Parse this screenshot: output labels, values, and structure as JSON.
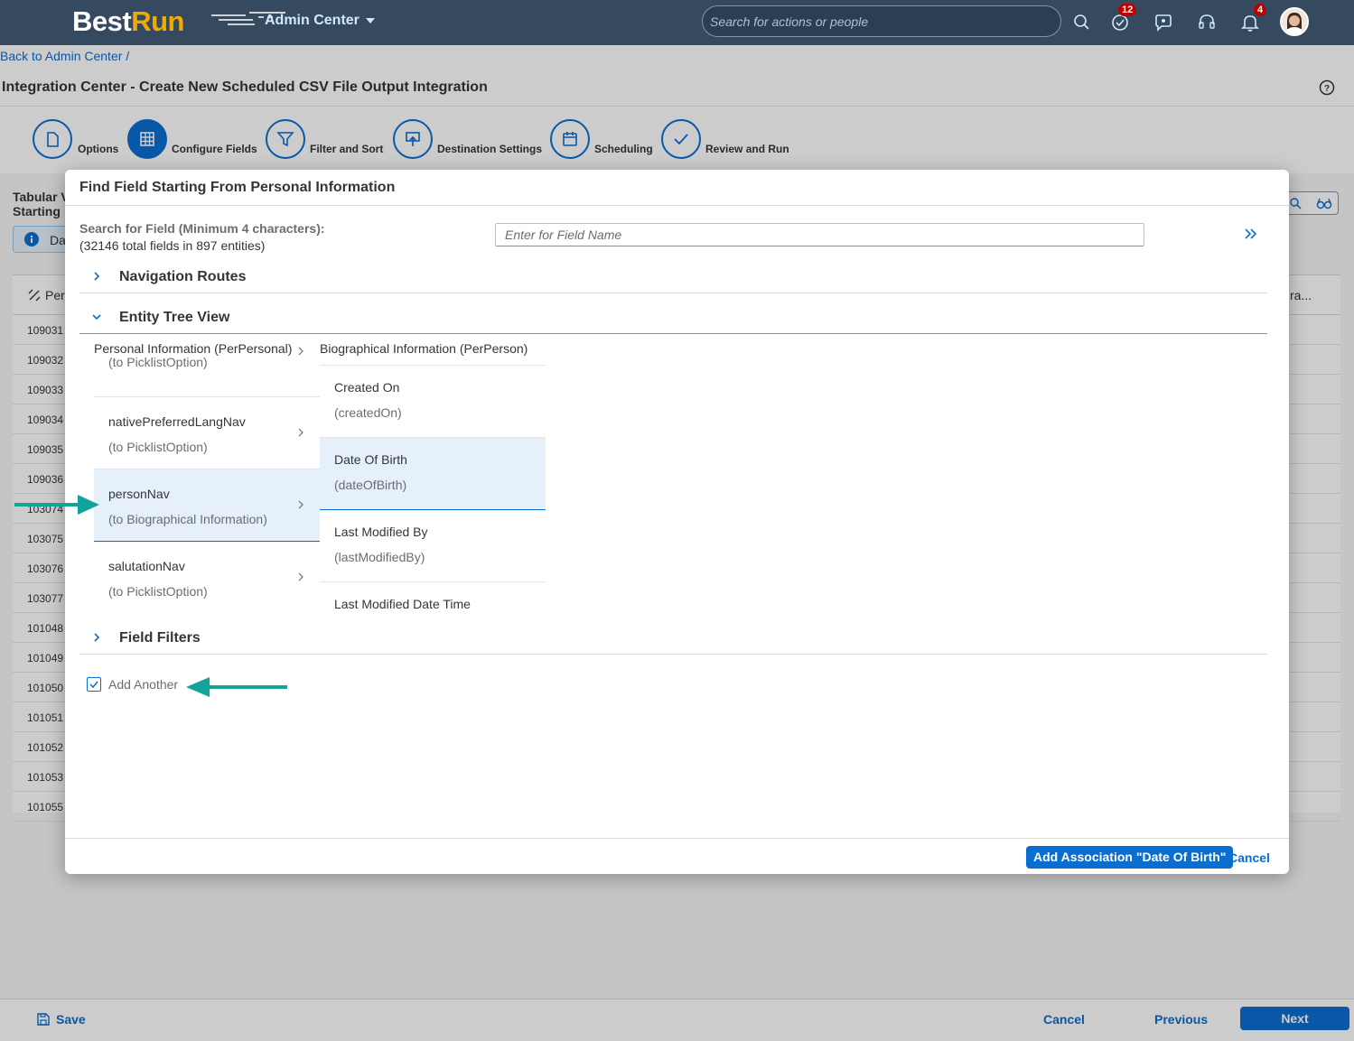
{
  "shell": {
    "logo_best": "Best",
    "logo_run": "Run",
    "menu_title": "Admin Center",
    "search_placeholder": "Search for actions or people",
    "todo_count": "12",
    "notif_count": "4",
    "brand_color": "#354a5f",
    "accent_color": "#f0ab00"
  },
  "breadcrumb": "Back to Admin Center /",
  "page_title": "Integration Center - Create New Scheduled CSV File Output Integration",
  "wizard": {
    "steps": [
      {
        "label": "Options",
        "icon": "document-icon",
        "active": false
      },
      {
        "label": "Configure Fields",
        "icon": "grid-icon",
        "active": true
      },
      {
        "label": "Filter and Sort",
        "icon": "filter-icon",
        "active": false
      },
      {
        "label": "Destination Settings",
        "icon": "upload-icon",
        "active": false
      },
      {
        "label": "Scheduling",
        "icon": "calendar-icon",
        "active": false
      },
      {
        "label": "Review and Run",
        "icon": "check-icon",
        "active": false
      }
    ]
  },
  "background": {
    "tab_line1": "Tabular V",
    "tab_line2": "Starting",
    "info_text": "Da",
    "col_partial": "Per",
    "col_partial_right": "ra...",
    "rows": [
      "109031",
      "109032",
      "109033",
      "109034",
      "109035",
      "109036",
      "103074",
      "103075",
      "103076",
      "103077",
      "101048",
      "101049",
      "101050",
      "101051",
      "101052",
      "101053",
      "101055"
    ]
  },
  "footer": {
    "save": "Save",
    "cancel": "Cancel",
    "previous": "Previous",
    "next": "Next"
  },
  "dialog": {
    "title": "Find Field Starting From Personal Information",
    "search_label": "Search for Field (Minimum 4 characters):",
    "search_sub": "(32146 total fields in 897 entities)",
    "search_placeholder": "Enter for Field Name",
    "sections": {
      "nav_routes": "Navigation Routes",
      "entity_tree": "Entity Tree View",
      "field_filters": "Field Filters"
    },
    "tree": {
      "col1_head": "Personal Information (PerPersonal)",
      "col1_items": [
        {
          "name": "",
          "target": "(to PicklistOption)"
        },
        {
          "name": "nativePreferredLangNav",
          "target": "(to PicklistOption)"
        },
        {
          "name": "personNav",
          "target": "(to Biographical Information)"
        },
        {
          "name": "salutationNav",
          "target": "(to PicklistOption)"
        }
      ],
      "col2_head": "Biographical Information (PerPerson)",
      "col2_items": [
        {
          "name": "Created On",
          "field": "(createdOn)"
        },
        {
          "name": "Date Of Birth",
          "field": "(dateOfBirth)"
        },
        {
          "name": "Last Modified By",
          "field": "(lastModifiedBy)"
        },
        {
          "name": "Last Modified Date Time",
          "field": ""
        }
      ]
    },
    "add_another": "Add Another",
    "add_association": "Add Association \"Date Of Birth\"",
    "cancel": "Cancel"
  }
}
